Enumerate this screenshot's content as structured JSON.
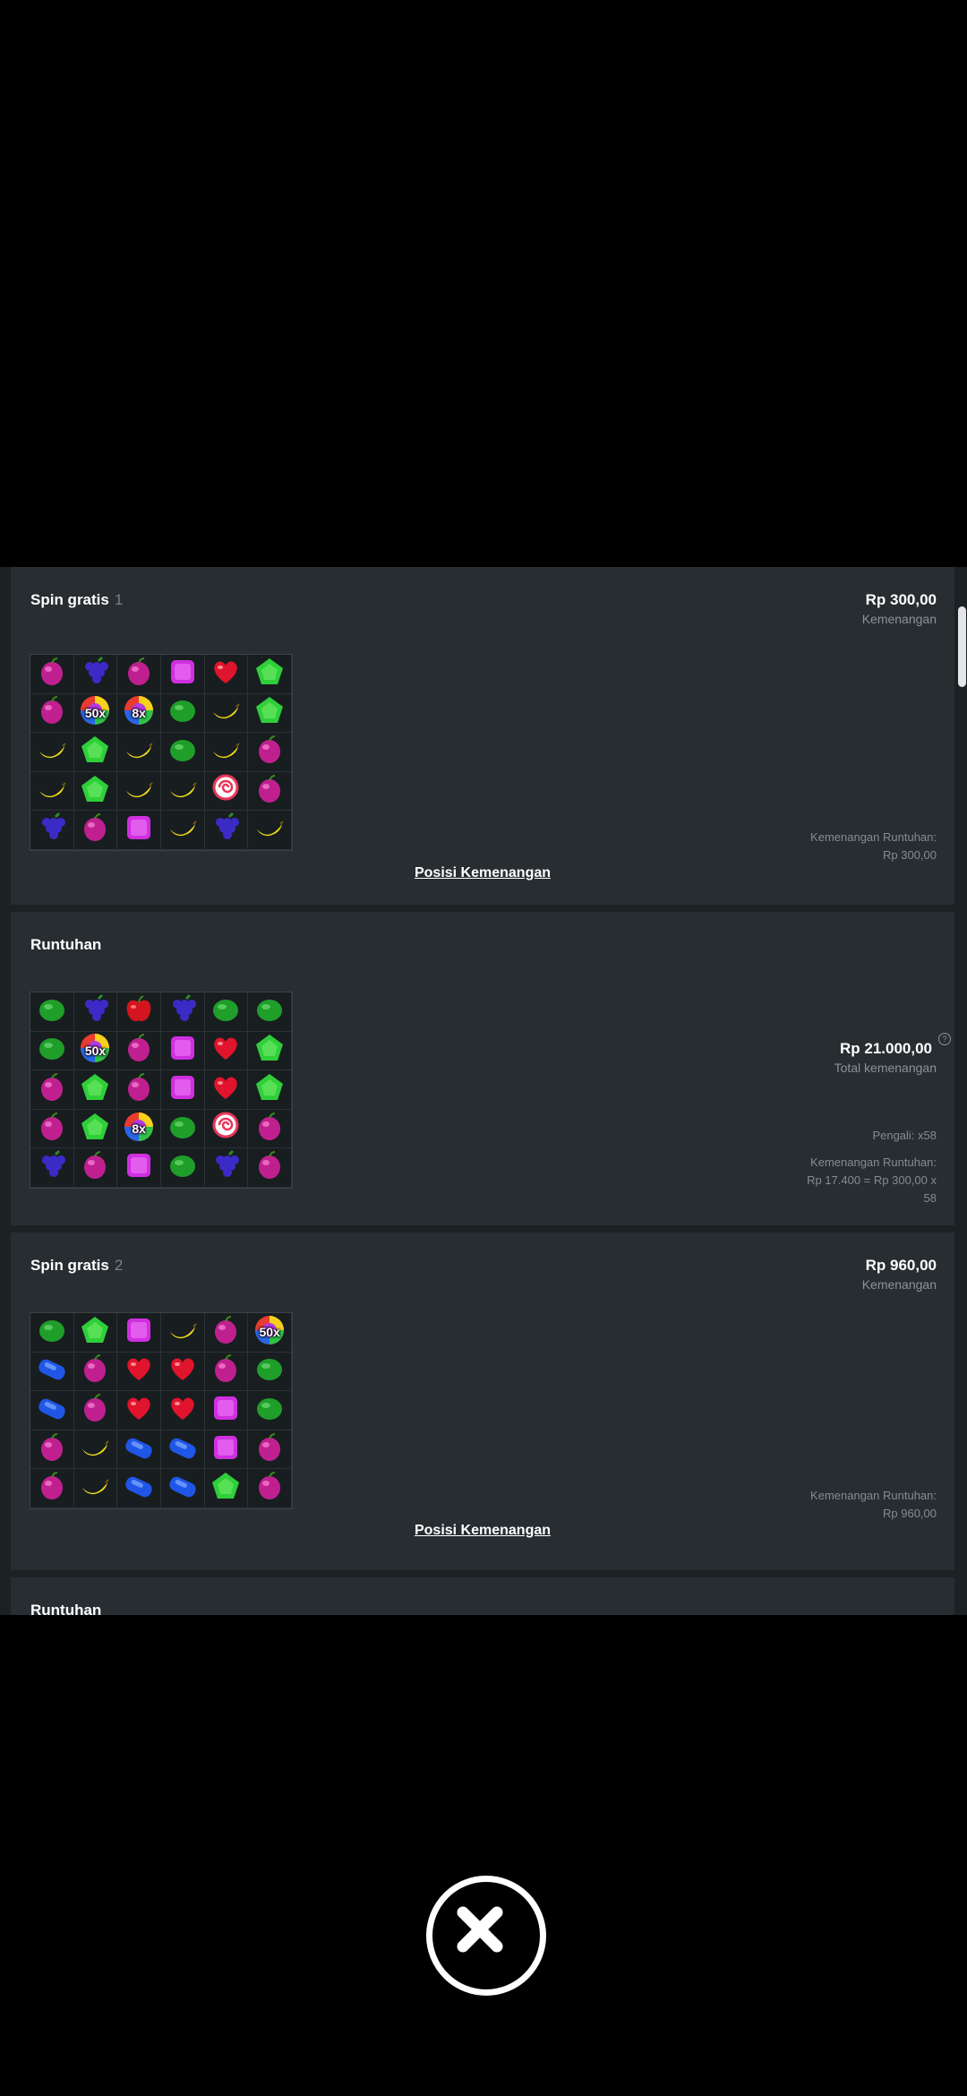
{
  "cards": [
    {
      "title": "Spin gratis",
      "number": "1",
      "amount": "Rp 300,00",
      "amount_label": "Kemenangan",
      "note_line1": "Kemenangan Runtuhan:",
      "note_line2": "Rp 300,00",
      "link": "Posisi Kemenangan",
      "grid": [
        [
          "plum",
          "grape",
          "plum",
          "square",
          "heart",
          "pentagon"
        ],
        [
          "plum",
          "rainbow-50x",
          "rainbow-8x",
          "watermelon",
          "banana",
          "pentagon"
        ],
        [
          "banana",
          "pentagon",
          "banana",
          "watermelon",
          "banana",
          "plum"
        ],
        [
          "banana",
          "pentagon",
          "banana",
          "banana",
          "lollipop",
          "plum"
        ],
        [
          "grape",
          "plum",
          "square",
          "banana",
          "grape",
          "banana"
        ]
      ]
    },
    {
      "title": "Runtuhan",
      "amount": "Rp 21.000,00",
      "amount_label": "Total kemenangan",
      "help": "?",
      "multiplier": "Pengali: x58",
      "note_line1": "Kemenangan Runtuhan:",
      "note_line2": "Rp 17.400 = Rp 300,00 x",
      "note_line3": "58",
      "grid": [
        [
          "watermelon",
          "grape",
          "apple",
          "grape",
          "watermelon",
          "watermelon"
        ],
        [
          "watermelon",
          "rainbow-50x",
          "plum",
          "square",
          "heart",
          "pentagon"
        ],
        [
          "plum",
          "pentagon",
          "plum",
          "square",
          "heart",
          "pentagon"
        ],
        [
          "plum",
          "pentagon",
          "rainbow-8x",
          "watermelon",
          "lollipop",
          "plum"
        ],
        [
          "grape",
          "plum",
          "square",
          "watermelon",
          "grape",
          "plum"
        ]
      ]
    },
    {
      "title": "Spin gratis",
      "number": "2",
      "amount": "Rp 960,00",
      "amount_label": "Kemenangan",
      "note_line1": "Kemenangan Runtuhan:",
      "note_line2": "Rp 960,00",
      "link": "Posisi Kemenangan",
      "grid": [
        [
          "watermelon",
          "pentagon",
          "square",
          "banana",
          "plum",
          "rainbow-50x"
        ],
        [
          "oblong",
          "plum",
          "heart",
          "heart",
          "plum",
          "watermelon"
        ],
        [
          "oblong",
          "plum",
          "heart",
          "heart",
          "square",
          "watermelon"
        ],
        [
          "plum",
          "banana",
          "oblong",
          "oblong",
          "square",
          "plum"
        ],
        [
          "plum",
          "banana",
          "oblong",
          "oblong",
          "pentagon",
          "plum"
        ]
      ]
    },
    {
      "title": "Runtuhan"
    }
  ],
  "multiplier_labels": {
    "rainbow-50x": "50x",
    "rainbow-8x": "8x"
  },
  "colors": {
    "panel_bg": "#1c2124",
    "card_bg": "#272d31",
    "plum": "#c0208f",
    "grape": "#3b2bc6",
    "square": "#d02fe0",
    "heart": "#e0142c",
    "pentagon": "#2fcf3a",
    "watermelon": "#1f9e2a",
    "banana": "#f1dc16",
    "lollipop": "#e8365a",
    "apple": "#d4141f",
    "oblong": "#1f56e6"
  },
  "close_button": {
    "icon": "close-icon"
  }
}
